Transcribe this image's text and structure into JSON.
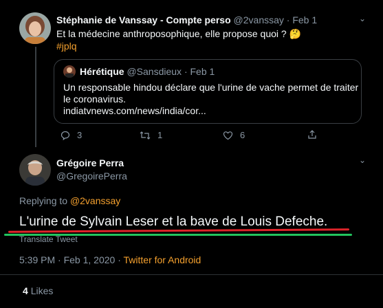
{
  "parent_tweet": {
    "display_name": "Stéphanie de Vanssay - Compte perso",
    "handle": "@2vanssay",
    "date": "· Feb 1",
    "text": "Et la médecine anthroposophique, elle propose quoi ?",
    "emoji": "🤔",
    "hashtag": "#jplq",
    "quoted": {
      "display_name": "Hérétique",
      "handle": "@Sansdieux",
      "date": "· Feb 1",
      "text_line1": "Un responsable hindou déclare que l'urine de vache permet de traiter",
      "text_line2": "le coronavirus.",
      "link": "indiatvnews.com/news/india/cor..."
    },
    "actions": {
      "replies": "3",
      "retweets": "1",
      "likes": "6"
    }
  },
  "main_tweet": {
    "display_name": "Grégoire Perra",
    "handle": "@GregoirePerra",
    "replying_prefix": "Replying to",
    "replying_handle": "@2vanssay",
    "text": "L'urine de Sylvain Leser et la bave de Louis Defeche.",
    "translate": "Translate Tweet",
    "time": "5:39 PM · Feb 1, 2020 ·",
    "source": "Twitter for Android",
    "likes_count": "4",
    "likes_label": "Likes"
  },
  "colors": {
    "background": "#000000",
    "accent_orange": "#f4a02e",
    "muted": "#8b98a5",
    "underline_red": "#e0242a",
    "underline_green": "#22c55e"
  },
  "icons": [
    "reply-icon",
    "retweet-icon",
    "like-icon",
    "share-icon",
    "chevron-down-icon"
  ]
}
